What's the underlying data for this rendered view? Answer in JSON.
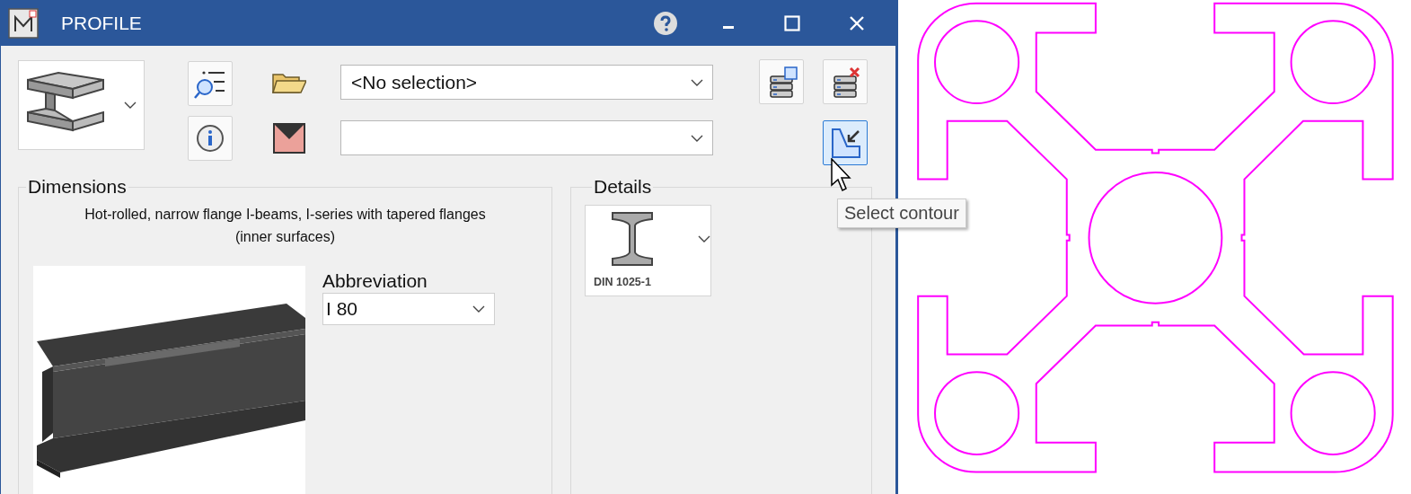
{
  "window": {
    "title": "PROFILE"
  },
  "profile_selector": {
    "kind": "i-beam"
  },
  "side_buttons": [
    {
      "kind": "find-list"
    },
    {
      "kind": "info"
    }
  ],
  "fields": [
    {
      "kind": "folder",
      "value": "<No selection>"
    },
    {
      "kind": "material"
    }
  ],
  "tool_buttons": [
    {
      "kind": "save-db",
      "selected": false
    },
    {
      "kind": "delete-db",
      "selected": false
    },
    {
      "kind": "select-contour",
      "selected": true
    }
  ],
  "dimensions": {
    "title": "Dimensions",
    "description": "Hot-rolled, narrow flange I-beams, I-series with tapered flanges (inner surfaces)",
    "abbreviation": {
      "label": "Abbreviation",
      "value": "I 80"
    }
  },
  "details": {
    "title": "Details",
    "standard": "DIN 1025-1"
  },
  "tooltip": {
    "text": "Select contour"
  }
}
